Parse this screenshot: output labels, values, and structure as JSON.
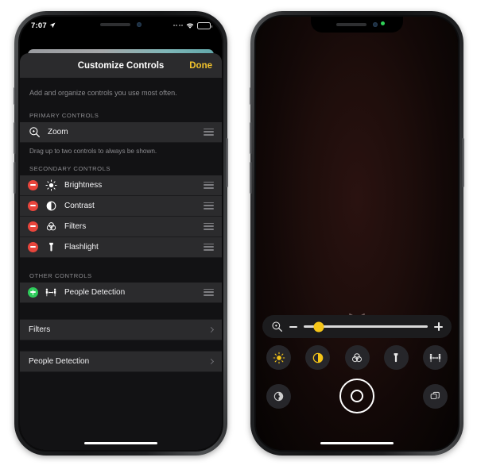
{
  "left_phone": {
    "status_bar": {
      "time": "7:07",
      "location_icon": "location-arrow-icon",
      "wifi_icon": "wifi-icon",
      "battery_icon": "battery-icon",
      "signal_icon": "cellular-dots-icon"
    },
    "sheet": {
      "title": "Customize Controls",
      "done_label": "Done",
      "intro": "Add and organize controls you use most often.",
      "sections": [
        {
          "header": "PRIMARY CONTROLS",
          "rows": [
            {
              "label": "Zoom",
              "icon": "magnifier-plus-icon",
              "badge": "none",
              "handle": "drag-handle-icon"
            }
          ],
          "hint": "Drag up to two controls to always be shown."
        },
        {
          "header": "SECONDARY CONTROLS",
          "rows": [
            {
              "label": "Brightness",
              "icon": "brightness-sun-icon",
              "badge": "minus",
              "handle": "drag-handle-icon"
            },
            {
              "label": "Contrast",
              "icon": "contrast-circle-icon",
              "badge": "minus",
              "handle": "drag-handle-icon"
            },
            {
              "label": "Filters",
              "icon": "filters-venn-icon",
              "badge": "minus",
              "handle": "drag-handle-icon"
            },
            {
              "label": "Flashlight",
              "icon": "flashlight-icon",
              "badge": "minus",
              "handle": "drag-handle-icon"
            }
          ],
          "hint": ""
        },
        {
          "header": "OTHER CONTROLS",
          "rows": [
            {
              "label": "People Detection",
              "icon": "people-detection-icon",
              "badge": "plus",
              "handle": "drag-handle-icon"
            }
          ],
          "hint": ""
        }
      ],
      "nav_rows": [
        {
          "label": "Filters",
          "chevron": "chevron-right-icon"
        },
        {
          "label": "People Detection",
          "chevron": "chevron-right-icon"
        }
      ]
    },
    "home_indicator": "home-indicator"
  },
  "right_phone": {
    "status_bar": {
      "privacy_dot": "camera-in-use-dot"
    },
    "magnifier": {
      "handle_icon": "chevron-down-handle-icon",
      "zoom_bar": {
        "left_icon": "magnifier-plus-icon",
        "decrease_label": "−",
        "increase_label": "+",
        "slider_value_percent": 12
      },
      "tools": [
        {
          "name": "brightness",
          "icon": "brightness-sun-icon",
          "active": true
        },
        {
          "name": "contrast",
          "icon": "contrast-circle-icon",
          "active": true
        },
        {
          "name": "filters",
          "icon": "filters-venn-icon",
          "active": false
        },
        {
          "name": "flashlight",
          "icon": "flashlight-icon",
          "active": false
        },
        {
          "name": "people-detection",
          "icon": "people-detection-icon",
          "active": false
        }
      ],
      "actions": {
        "settings_icon": "settings-contrast-icon",
        "shutter_icon": "shutter-button",
        "multi_window_icon": "multi-window-icon"
      }
    },
    "home_indicator": "home-indicator"
  },
  "colors": {
    "accent_yellow": "#f2c32c",
    "remove_red": "#e8453c",
    "add_green": "#2ecc5b",
    "sheet_bg": "#1c1c1e",
    "row_bg": "#2b2b2d",
    "page_bg": "#121214",
    "privacy_green": "#30d158"
  }
}
